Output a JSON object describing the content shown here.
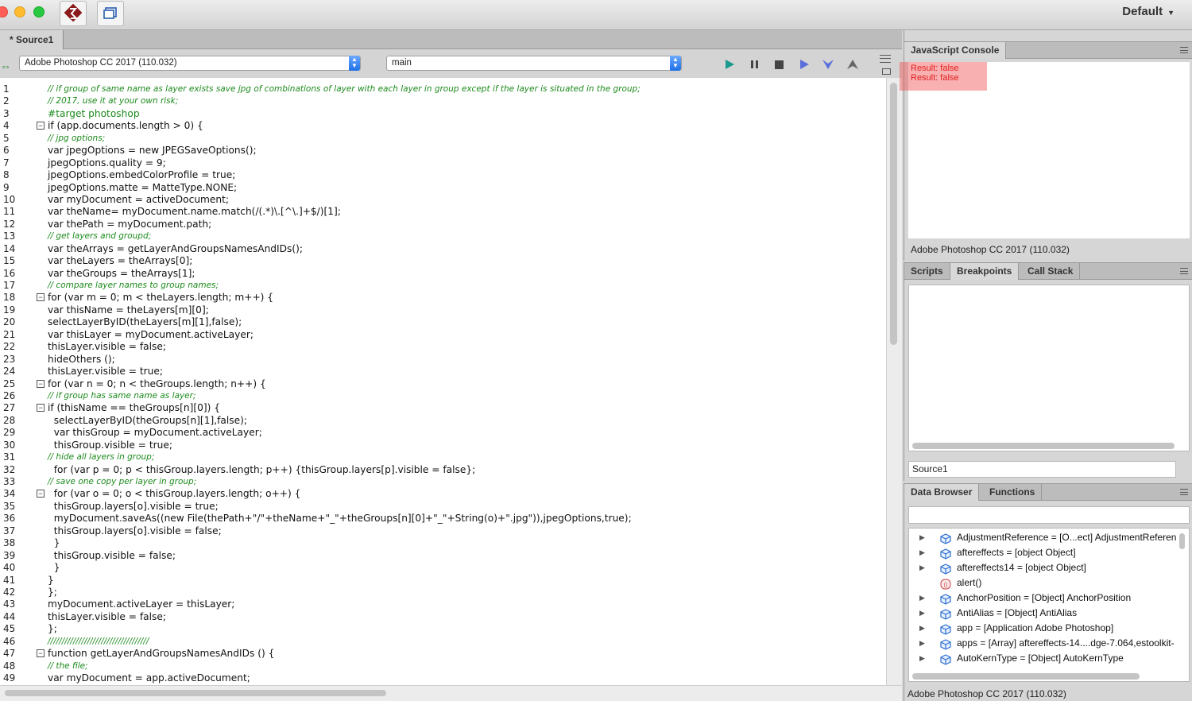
{
  "window": {
    "workspace_label": "Default"
  },
  "editor": {
    "tab_label": "* Source1",
    "target_app": "Adobe Photoshop CC 2017 (110.032)",
    "engine": "main",
    "controls": [
      "run-icon",
      "pause-icon",
      "stop-icon",
      "step-over-icon",
      "step-into-icon",
      "step-out-icon"
    ],
    "lines": [
      {
        "n": "1",
        "text": "// if group of same name as layer exists save jpg of combinations of layer with each layer in group except if the layer is situated in the group;",
        "kind": "comment"
      },
      {
        "n": "2",
        "text": "// 2017, use it at your own risk;",
        "kind": "comment"
      },
      {
        "n": "3",
        "text": "#target photoshop",
        "kind": "directive"
      },
      {
        "n": "4",
        "text": "if (app.documents.length > 0) {",
        "kind": "code",
        "fold": true
      },
      {
        "n": "5",
        "text": "// jpg options;",
        "kind": "comment"
      },
      {
        "n": "6",
        "text": "var jpegOptions = new JPEGSaveOptions();",
        "kind": "code"
      },
      {
        "n": "7",
        "text": "jpegOptions.quality = 9;",
        "kind": "code"
      },
      {
        "n": "8",
        "text": "jpegOptions.embedColorProfile = true;",
        "kind": "code"
      },
      {
        "n": "9",
        "text": "jpegOptions.matte = MatteType.NONE;",
        "kind": "code"
      },
      {
        "n": "10",
        "text": "var myDocument = activeDocument;",
        "kind": "code"
      },
      {
        "n": "11",
        "text": "var theName= myDocument.name.match(/(.*)\\.[^\\.]+$/)[1];",
        "kind": "code"
      },
      {
        "n": "12",
        "text": "var thePath = myDocument.path;",
        "kind": "code"
      },
      {
        "n": "13",
        "text": "// get layers and groupd;",
        "kind": "comment"
      },
      {
        "n": "14",
        "text": "var theArrays = getLayerAndGroupsNamesAndIDs();",
        "kind": "code"
      },
      {
        "n": "15",
        "text": "var theLayers = theArrays[0];",
        "kind": "code"
      },
      {
        "n": "16",
        "text": "var theGroups = theArrays[1];",
        "kind": "code"
      },
      {
        "n": "17",
        "text": "// compare layer names to group names;",
        "kind": "comment"
      },
      {
        "n": "18",
        "text": "for (var m = 0; m < theLayers.length; m++) {",
        "kind": "code",
        "fold": true
      },
      {
        "n": "19",
        "text": "var thisName = theLayers[m][0];",
        "kind": "code"
      },
      {
        "n": "20",
        "text": "selectLayerByID(theLayers[m][1],false);",
        "kind": "code"
      },
      {
        "n": "21",
        "text": "var thisLayer = myDocument.activeLayer;",
        "kind": "code"
      },
      {
        "n": "22",
        "text": "thisLayer.visible = false;",
        "kind": "code"
      },
      {
        "n": "23",
        "text": "hideOthers ();",
        "kind": "code"
      },
      {
        "n": "24",
        "text": "thisLayer.visible = true;",
        "kind": "code"
      },
      {
        "n": "25",
        "text": "for (var n = 0; n < theGroups.length; n++) {",
        "kind": "code",
        "fold": true
      },
      {
        "n": "26",
        "text": "// if group has same name as layer;",
        "kind": "comment"
      },
      {
        "n": "27",
        "text": "if (thisName == theGroups[n][0]) {",
        "kind": "code",
        "fold": true
      },
      {
        "n": "28",
        "text": "  selectLayerByID(theGroups[n][1],false);",
        "kind": "code"
      },
      {
        "n": "29",
        "text": "  var thisGroup = myDocument.activeLayer;",
        "kind": "code"
      },
      {
        "n": "30",
        "text": "  thisGroup.visible = true;",
        "kind": "code"
      },
      {
        "n": "31",
        "text": "// hide all layers in group;",
        "kind": "comment"
      },
      {
        "n": "32",
        "text": "  for (var p = 0; p < thisGroup.layers.length; p++) {thisGroup.layers[p].visible = false};",
        "kind": "code"
      },
      {
        "n": "33",
        "text": "// save one copy per layer in group;",
        "kind": "comment"
      },
      {
        "n": "34",
        "text": "  for (var o = 0; o < thisGroup.layers.length; o++) {",
        "kind": "code",
        "fold": true
      },
      {
        "n": "35",
        "text": "  thisGroup.layers[o].visible = true;",
        "kind": "code"
      },
      {
        "n": "36",
        "text": "  myDocument.saveAs((new File(thePath+\"/\"+theName+\"_\"+theGroups[n][0]+\"_\"+String(o)+\".jpg\")),jpegOptions,true);",
        "kind": "code"
      },
      {
        "n": "37",
        "text": "  thisGroup.layers[o].visible = false;",
        "kind": "code"
      },
      {
        "n": "38",
        "text": "  }",
        "kind": "code"
      },
      {
        "n": "39",
        "text": "  thisGroup.visible = false;",
        "kind": "code"
      },
      {
        "n": "40",
        "text": "  }",
        "kind": "code"
      },
      {
        "n": "41",
        "text": "}",
        "kind": "code"
      },
      {
        "n": "42",
        "text": "};",
        "kind": "code"
      },
      {
        "n": "43",
        "text": "myDocument.activeLayer = thisLayer;",
        "kind": "code"
      },
      {
        "n": "44",
        "text": "thisLayer.visible = false;",
        "kind": "code"
      },
      {
        "n": "45",
        "text": "};",
        "kind": "code"
      },
      {
        "n": "46",
        "text": "////////////////////////////////////",
        "kind": "comment"
      },
      {
        "n": "47",
        "text": "function getLayerAndGroupsNamesAndIDs () {",
        "kind": "code",
        "fold": true
      },
      {
        "n": "48",
        "text": "// the file;",
        "kind": "comment"
      },
      {
        "n": "49",
        "text": "var myDocument = app.activeDocument;",
        "kind": "code"
      }
    ]
  },
  "console": {
    "tab_label": "JavaScript Console",
    "results": [
      "Result: false",
      "Result: false"
    ],
    "status": "Adobe Photoshop CC 2017 (110.032)"
  },
  "scripts_panel": {
    "tabs": [
      "Scripts",
      "Breakpoints",
      "Call Stack"
    ],
    "source_field": "Source1"
  },
  "data_browser": {
    "tabs": [
      "Data Browser",
      "Functions"
    ],
    "search_value": "",
    "items": [
      {
        "label": "AdjustmentReference = [O...ect] AdjustmentReferen",
        "expandable": true,
        "icon": "object-cube-icon"
      },
      {
        "label": "aftereffects = [object Object]",
        "expandable": true,
        "icon": "object-cube-icon"
      },
      {
        "label": "aftereffects14 = [object Object]",
        "expandable": true,
        "icon": "object-cube-icon"
      },
      {
        "label": "alert()",
        "expandable": false,
        "icon": "function-icon"
      },
      {
        "label": "AnchorPosition = [Object] AnchorPosition",
        "expandable": true,
        "icon": "object-cube-icon"
      },
      {
        "label": "AntiAlias = [Object] AntiAlias",
        "expandable": true,
        "icon": "object-cube-icon"
      },
      {
        "label": "app = [Application Adobe Photoshop]",
        "expandable": true,
        "icon": "object-cube-icon"
      },
      {
        "label": "apps = [Array] aftereffects-14....dge-7.064,estoolkit-",
        "expandable": true,
        "icon": "object-cube-icon"
      },
      {
        "label": "AutoKernType = [Object] AutoKernType",
        "expandable": true,
        "icon": "object-cube-icon"
      }
    ],
    "status": "Adobe Photoshop CC 2017 (110.032)"
  }
}
